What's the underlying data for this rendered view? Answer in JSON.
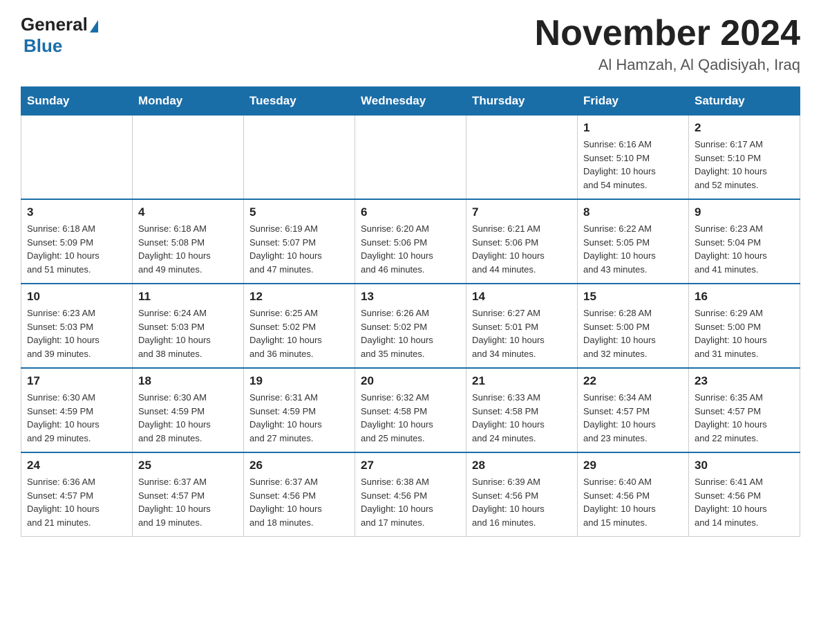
{
  "header": {
    "title": "November 2024",
    "subtitle": "Al Hamzah, Al Qadisiyah, Iraq",
    "logo": {
      "general": "General",
      "blue": "Blue"
    }
  },
  "weekdays": [
    "Sunday",
    "Monday",
    "Tuesday",
    "Wednesday",
    "Thursday",
    "Friday",
    "Saturday"
  ],
  "weeks": [
    [
      {
        "day": "",
        "info": ""
      },
      {
        "day": "",
        "info": ""
      },
      {
        "day": "",
        "info": ""
      },
      {
        "day": "",
        "info": ""
      },
      {
        "day": "",
        "info": ""
      },
      {
        "day": "1",
        "info": "Sunrise: 6:16 AM\nSunset: 5:10 PM\nDaylight: 10 hours\nand 54 minutes."
      },
      {
        "day": "2",
        "info": "Sunrise: 6:17 AM\nSunset: 5:10 PM\nDaylight: 10 hours\nand 52 minutes."
      }
    ],
    [
      {
        "day": "3",
        "info": "Sunrise: 6:18 AM\nSunset: 5:09 PM\nDaylight: 10 hours\nand 51 minutes."
      },
      {
        "day": "4",
        "info": "Sunrise: 6:18 AM\nSunset: 5:08 PM\nDaylight: 10 hours\nand 49 minutes."
      },
      {
        "day": "5",
        "info": "Sunrise: 6:19 AM\nSunset: 5:07 PM\nDaylight: 10 hours\nand 47 minutes."
      },
      {
        "day": "6",
        "info": "Sunrise: 6:20 AM\nSunset: 5:06 PM\nDaylight: 10 hours\nand 46 minutes."
      },
      {
        "day": "7",
        "info": "Sunrise: 6:21 AM\nSunset: 5:06 PM\nDaylight: 10 hours\nand 44 minutes."
      },
      {
        "day": "8",
        "info": "Sunrise: 6:22 AM\nSunset: 5:05 PM\nDaylight: 10 hours\nand 43 minutes."
      },
      {
        "day": "9",
        "info": "Sunrise: 6:23 AM\nSunset: 5:04 PM\nDaylight: 10 hours\nand 41 minutes."
      }
    ],
    [
      {
        "day": "10",
        "info": "Sunrise: 6:23 AM\nSunset: 5:03 PM\nDaylight: 10 hours\nand 39 minutes."
      },
      {
        "day": "11",
        "info": "Sunrise: 6:24 AM\nSunset: 5:03 PM\nDaylight: 10 hours\nand 38 minutes."
      },
      {
        "day": "12",
        "info": "Sunrise: 6:25 AM\nSunset: 5:02 PM\nDaylight: 10 hours\nand 36 minutes."
      },
      {
        "day": "13",
        "info": "Sunrise: 6:26 AM\nSunset: 5:02 PM\nDaylight: 10 hours\nand 35 minutes."
      },
      {
        "day": "14",
        "info": "Sunrise: 6:27 AM\nSunset: 5:01 PM\nDaylight: 10 hours\nand 34 minutes."
      },
      {
        "day": "15",
        "info": "Sunrise: 6:28 AM\nSunset: 5:00 PM\nDaylight: 10 hours\nand 32 minutes."
      },
      {
        "day": "16",
        "info": "Sunrise: 6:29 AM\nSunset: 5:00 PM\nDaylight: 10 hours\nand 31 minutes."
      }
    ],
    [
      {
        "day": "17",
        "info": "Sunrise: 6:30 AM\nSunset: 4:59 PM\nDaylight: 10 hours\nand 29 minutes."
      },
      {
        "day": "18",
        "info": "Sunrise: 6:30 AM\nSunset: 4:59 PM\nDaylight: 10 hours\nand 28 minutes."
      },
      {
        "day": "19",
        "info": "Sunrise: 6:31 AM\nSunset: 4:59 PM\nDaylight: 10 hours\nand 27 minutes."
      },
      {
        "day": "20",
        "info": "Sunrise: 6:32 AM\nSunset: 4:58 PM\nDaylight: 10 hours\nand 25 minutes."
      },
      {
        "day": "21",
        "info": "Sunrise: 6:33 AM\nSunset: 4:58 PM\nDaylight: 10 hours\nand 24 minutes."
      },
      {
        "day": "22",
        "info": "Sunrise: 6:34 AM\nSunset: 4:57 PM\nDaylight: 10 hours\nand 23 minutes."
      },
      {
        "day": "23",
        "info": "Sunrise: 6:35 AM\nSunset: 4:57 PM\nDaylight: 10 hours\nand 22 minutes."
      }
    ],
    [
      {
        "day": "24",
        "info": "Sunrise: 6:36 AM\nSunset: 4:57 PM\nDaylight: 10 hours\nand 21 minutes."
      },
      {
        "day": "25",
        "info": "Sunrise: 6:37 AM\nSunset: 4:57 PM\nDaylight: 10 hours\nand 19 minutes."
      },
      {
        "day": "26",
        "info": "Sunrise: 6:37 AM\nSunset: 4:56 PM\nDaylight: 10 hours\nand 18 minutes."
      },
      {
        "day": "27",
        "info": "Sunrise: 6:38 AM\nSunset: 4:56 PM\nDaylight: 10 hours\nand 17 minutes."
      },
      {
        "day": "28",
        "info": "Sunrise: 6:39 AM\nSunset: 4:56 PM\nDaylight: 10 hours\nand 16 minutes."
      },
      {
        "day": "29",
        "info": "Sunrise: 6:40 AM\nSunset: 4:56 PM\nDaylight: 10 hours\nand 15 minutes."
      },
      {
        "day": "30",
        "info": "Sunrise: 6:41 AM\nSunset: 4:56 PM\nDaylight: 10 hours\nand 14 minutes."
      }
    ]
  ]
}
